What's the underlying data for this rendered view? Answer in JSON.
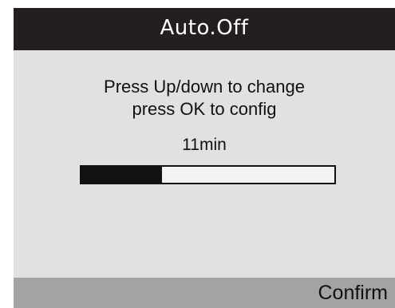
{
  "screen": {
    "title": "Auto.Off",
    "instructions": [
      "Press Up/down to change",
      "press OK to config"
    ],
    "current_value": "11min",
    "progress": {
      "fraction": 0.32
    },
    "footer": {
      "confirm_label": "Confirm"
    },
    "colors": {
      "title_background": "#231f20",
      "screen_background": "#e1e1e1",
      "footer_background": "#a3a3a3",
      "progress_fill": "#111111"
    }
  }
}
